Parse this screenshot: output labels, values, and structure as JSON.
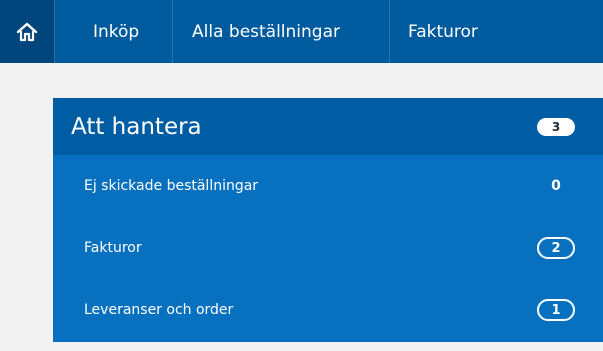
{
  "nav": {
    "home_icon": "home-icon",
    "items": [
      {
        "label": "Inköp"
      },
      {
        "label": "Alla beställningar"
      },
      {
        "label": "Fakturor"
      }
    ]
  },
  "panel": {
    "title": "Att hantera",
    "total": "3",
    "rows": [
      {
        "label": "Ej skickade beställningar",
        "count": "0"
      },
      {
        "label": "Fakturor",
        "count": "2"
      },
      {
        "label": "Leveranser och order",
        "count": "1"
      }
    ]
  },
  "colors": {
    "nav_bg": "#005a9e",
    "panel_header_bg": "#005da4",
    "panel_bg": "#0770bf",
    "page_bg": "#f2f2f2"
  }
}
